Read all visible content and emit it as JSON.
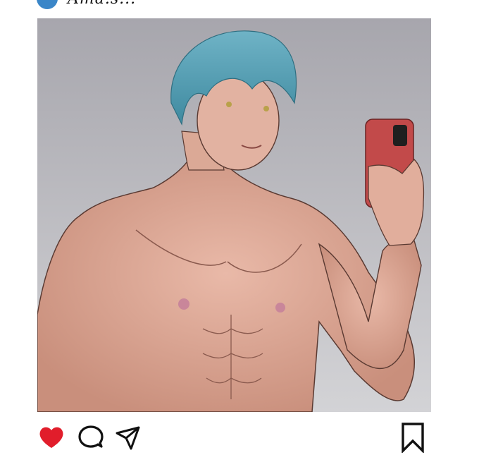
{
  "post": {
    "username": "Ama.s...",
    "liked": true,
    "saved": false
  },
  "icons": {
    "like": "heart-icon",
    "comment": "comment-bubble-icon",
    "share": "paper-plane-icon",
    "save": "bookmark-icon"
  },
  "colors": {
    "accent": "#3a86c8",
    "like_active": "#e11d2b",
    "icon_stroke": "#111111",
    "phone_case": "#c24a4a",
    "hair": "#5ca4b8",
    "background_gradient_top": "#a8a6ae",
    "background_gradient_bottom": "#cfcfd3"
  }
}
